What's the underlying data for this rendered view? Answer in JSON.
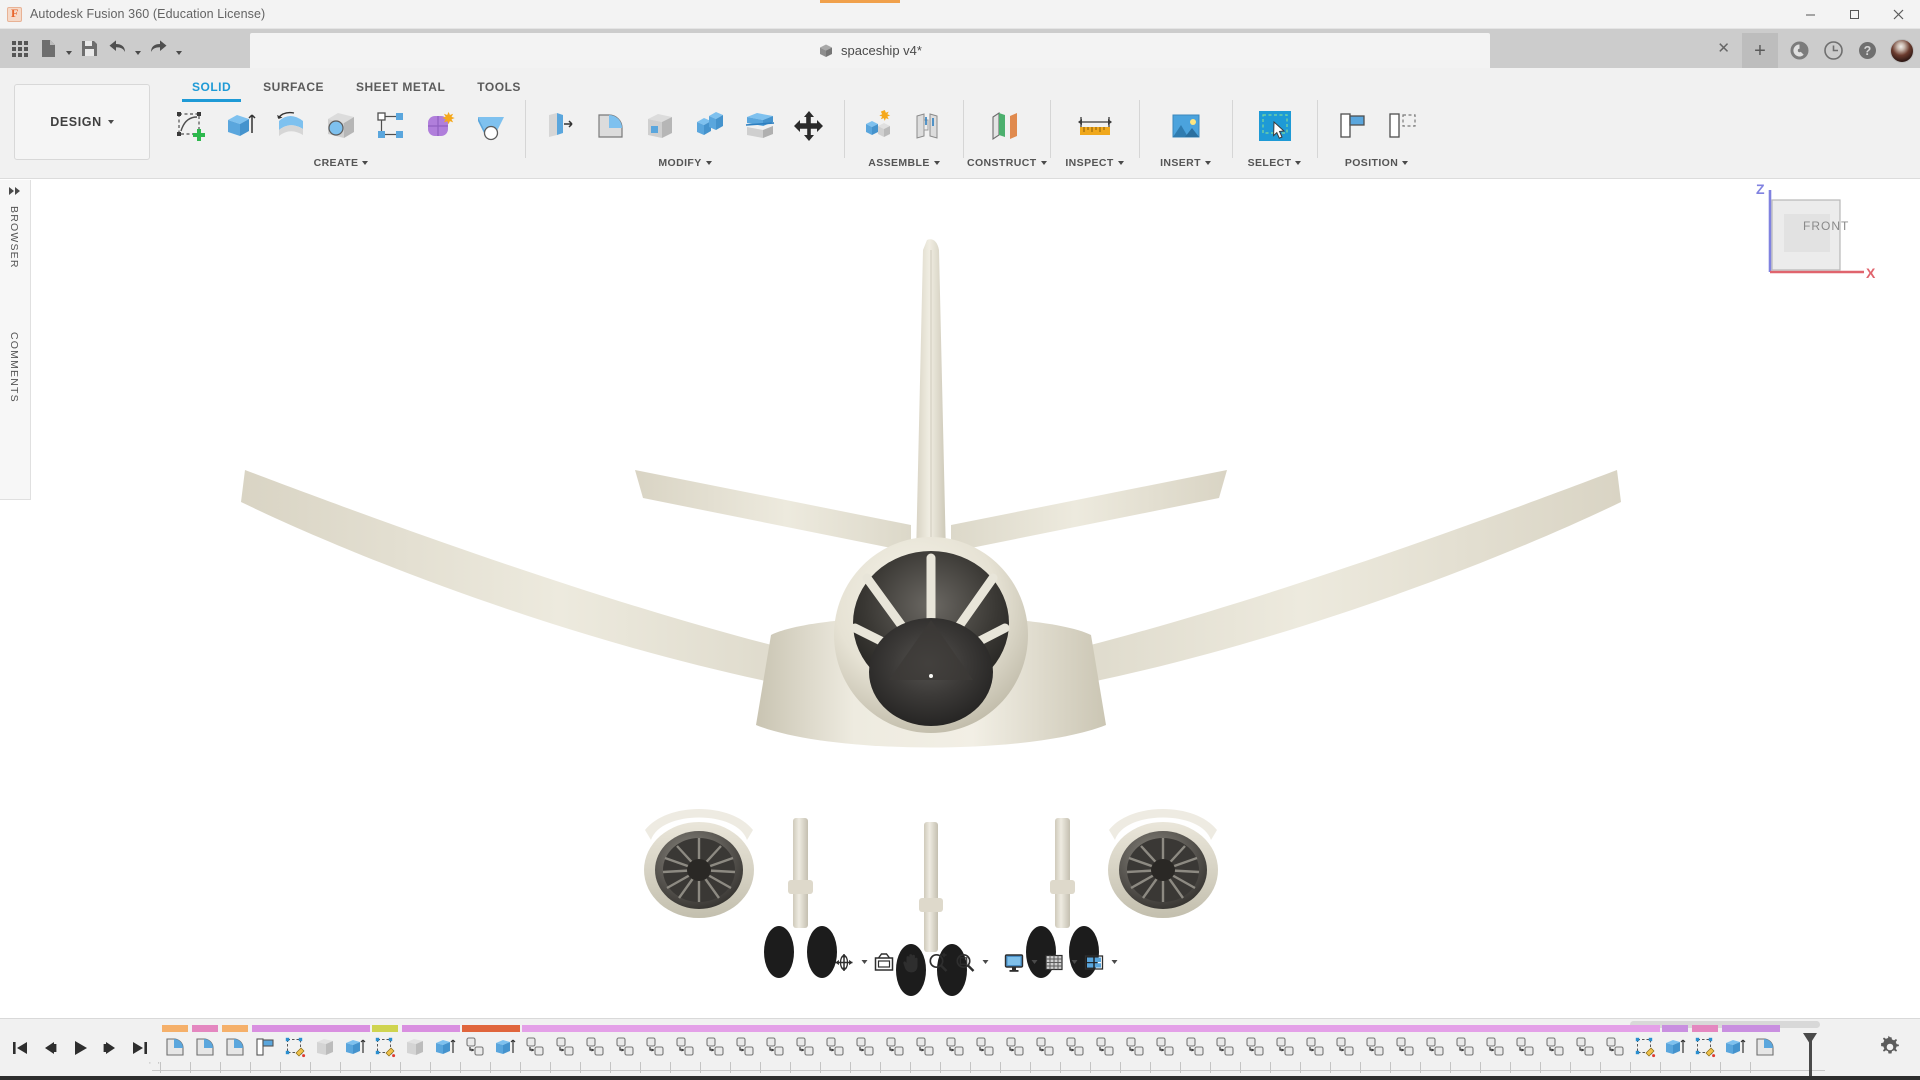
{
  "window": {
    "app_title": "Autodesk Fusion 360 (Education License)",
    "logo_icon": "fusion-logo-icon",
    "minimize_label": "–",
    "maximize_label": "❐",
    "close_label": "✕"
  },
  "quick_access": {
    "app_grid_icon": "app-grid-icon",
    "new_file_icon": "new-file-icon",
    "save_icon": "save-icon",
    "undo_icon": "undo-icon",
    "redo_icon": "redo-icon"
  },
  "document_tab": {
    "title": "spaceship v4*",
    "doc_icon": "cube-icon",
    "close_label": "✕",
    "new_tab_label": "+"
  },
  "top_right": {
    "extensions_icon": "extension-icon",
    "job_status_icon": "clock-icon",
    "help_icon": "help-icon",
    "account_avatar": "user-avatar"
  },
  "ribbon": {
    "workspace": {
      "label": "DESIGN",
      "caret": "▾"
    },
    "tabs": [
      {
        "label": "SOLID",
        "active": true
      },
      {
        "label": "SURFACE",
        "active": false
      },
      {
        "label": "SHEET METAL",
        "active": false
      },
      {
        "label": "TOOLS",
        "active": false
      }
    ],
    "panels": [
      {
        "label": "CREATE",
        "caret": "▾",
        "tools": [
          {
            "name": "create-sketch-tool",
            "icon": "sketch-plus-icon"
          },
          {
            "name": "extrude-tool",
            "icon": "extrude-icon"
          },
          {
            "name": "revolve-tool",
            "icon": "revolve-icon"
          },
          {
            "name": "sweep-tool",
            "icon": "sweep-icon"
          },
          {
            "name": "pattern-tool",
            "icon": "rectangular-pattern-icon"
          },
          {
            "name": "form-tool",
            "icon": "form-sculpt-icon"
          },
          {
            "name": "create-hole-tool",
            "icon": "hole-icon"
          }
        ]
      },
      {
        "label": "MODIFY",
        "caret": "▾",
        "tools": [
          {
            "name": "press-pull-tool",
            "icon": "press-pull-icon"
          },
          {
            "name": "fillet-tool",
            "icon": "fillet-icon"
          },
          {
            "name": "shell-tool",
            "icon": "shell-icon"
          },
          {
            "name": "combine-tool",
            "icon": "combine-icon"
          },
          {
            "name": "split-face-tool",
            "icon": "split-face-icon"
          },
          {
            "name": "move-copy-tool",
            "icon": "move-copy-icon"
          }
        ]
      },
      {
        "label": "ASSEMBLE",
        "caret": "▾",
        "tools": [
          {
            "name": "new-component-tool",
            "icon": "new-component-icon"
          },
          {
            "name": "joint-tool",
            "icon": "joint-icon"
          }
        ]
      },
      {
        "label": "CONSTRUCT",
        "caret": "▾",
        "tools": [
          {
            "name": "offset-plane-tool",
            "icon": "offset-plane-icon"
          }
        ]
      },
      {
        "label": "INSPECT",
        "caret": "▾",
        "tools": [
          {
            "name": "measure-tool",
            "icon": "measure-ruler-icon"
          }
        ]
      },
      {
        "label": "INSERT",
        "caret": "▾",
        "tools": [
          {
            "name": "insert-canvas-tool",
            "icon": "image-icon"
          }
        ]
      },
      {
        "label": "SELECT",
        "caret": "▾",
        "tools": [
          {
            "name": "select-tool",
            "icon": "window-select-icon",
            "active": true
          }
        ]
      },
      {
        "label": "POSITION",
        "caret": "▾",
        "tools": [
          {
            "name": "align-tool",
            "icon": "align-icon"
          },
          {
            "name": "move-position-tool",
            "icon": "position-move-icon"
          }
        ]
      }
    ]
  },
  "left_rail": {
    "collapse_icon": "double-arrow-right-icon",
    "panels": [
      {
        "label": "BROWSER"
      },
      {
        "label": "COMMENTS"
      }
    ]
  },
  "viewcube": {
    "face_label": "FRONT",
    "axis_z_label": "Z",
    "axis_x_label": "X",
    "axis_z_color": "#7b7ce0",
    "axis_x_color": "#e06a72"
  },
  "canvas": {
    "background": "#ffffff",
    "model_name": "airplane-front-view",
    "body_color": "#e6e2d6",
    "engine_color": "#4a4a4a",
    "tire_color": "#1f1f1f"
  },
  "nav_bar": {
    "items": [
      {
        "name": "orbit-button",
        "icon": "orbit-icon",
        "caret": true
      },
      {
        "name": "look-at-button",
        "icon": "look-at-icon",
        "caret": false
      },
      {
        "name": "pan-button",
        "icon": "pan-hand-icon",
        "caret": false
      },
      {
        "name": "zoom-button",
        "icon": "zoom-magnifier-icon",
        "caret": false
      },
      {
        "name": "fit-button",
        "icon": "zoom-fit-icon",
        "caret": true
      },
      {
        "name": "display-settings-button",
        "icon": "monitor-icon",
        "caret": true
      },
      {
        "name": "grid-snaps-button",
        "icon": "grid-icon",
        "caret": true
      },
      {
        "name": "viewports-button",
        "icon": "viewports-icon",
        "caret": true
      }
    ]
  },
  "timeline": {
    "transport": [
      {
        "name": "go-to-beginning-button",
        "icon": "skip-back-icon"
      },
      {
        "name": "step-back-button",
        "icon": "step-back-icon"
      },
      {
        "name": "play-button",
        "icon": "play-icon"
      },
      {
        "name": "step-forward-button",
        "icon": "step-forward-icon"
      },
      {
        "name": "go-to-end-button",
        "icon": "skip-end-icon"
      }
    ],
    "settings_icon": "gear-icon",
    "dots_label": "· ·",
    "features": [
      {
        "icon": "fillet-icon",
        "bar": "#f5b06a"
      },
      {
        "icon": "fillet-icon",
        "bar": "#e487c0"
      },
      {
        "icon": "fillet-icon",
        "bar": "#f5b06a"
      },
      {
        "icon": "align-icon",
        "bar": "#d98fe0"
      },
      {
        "icon": "sketch-icon",
        "bar": "#d98fe0"
      },
      {
        "icon": "shell-icon",
        "bar": "#d98fe0"
      },
      {
        "icon": "extrude-icon",
        "bar": "#d98fe0"
      },
      {
        "icon": "sketch-icon",
        "bar": "#cfd44f"
      },
      {
        "icon": "shell-icon",
        "bar": "#d98fe0"
      },
      {
        "icon": "extrude-icon",
        "bar": "#d98fe0"
      },
      {
        "icon": "copy-paste-icon",
        "bar": "#e0653c"
      },
      {
        "icon": "extrude-icon",
        "bar": "#e0653c"
      },
      {
        "icon": "copy-paste-icon",
        "bar": "#e4a0e8"
      },
      {
        "icon": "copy-paste-icon",
        "bar": "#e4a0e8"
      },
      {
        "icon": "copy-paste-icon",
        "bar": "#e4a0e8"
      },
      {
        "icon": "copy-paste-icon",
        "bar": "#e4a0e8"
      },
      {
        "icon": "copy-paste-icon",
        "bar": "#e4a0e8"
      },
      {
        "icon": "copy-paste-icon",
        "bar": "#e4a0e8"
      },
      {
        "icon": "copy-paste-icon",
        "bar": "#e4a0e8"
      },
      {
        "icon": "copy-paste-icon",
        "bar": "#e4a0e8"
      },
      {
        "icon": "copy-paste-icon",
        "bar": "#e4a0e8"
      },
      {
        "icon": "copy-paste-icon",
        "bar": "#e4a0e8"
      },
      {
        "icon": "copy-paste-icon",
        "bar": "#e4a0e8"
      },
      {
        "icon": "copy-paste-icon",
        "bar": "#e4a0e8"
      },
      {
        "icon": "copy-paste-icon",
        "bar": "#e4a0e8"
      },
      {
        "icon": "copy-paste-icon",
        "bar": "#e4a0e8"
      },
      {
        "icon": "copy-paste-icon",
        "bar": "#e4a0e8"
      },
      {
        "icon": "copy-paste-icon",
        "bar": "#e4a0e8"
      },
      {
        "icon": "copy-paste-icon",
        "bar": "#e4a0e8"
      },
      {
        "icon": "copy-paste-icon",
        "bar": "#e4a0e8"
      },
      {
        "icon": "copy-paste-icon",
        "bar": "#e4a0e8"
      },
      {
        "icon": "copy-paste-icon",
        "bar": "#e4a0e8"
      },
      {
        "icon": "copy-paste-icon",
        "bar": "#e4a0e8"
      },
      {
        "icon": "copy-paste-icon",
        "bar": "#e4a0e8"
      },
      {
        "icon": "copy-paste-icon",
        "bar": "#e4a0e8"
      },
      {
        "icon": "copy-paste-icon",
        "bar": "#e4a0e8"
      },
      {
        "icon": "copy-paste-icon",
        "bar": "#e4a0e8"
      },
      {
        "icon": "copy-paste-icon",
        "bar": "#e4a0e8"
      },
      {
        "icon": "copy-paste-icon",
        "bar": "#e4a0e8"
      },
      {
        "icon": "copy-paste-icon",
        "bar": "#e4a0e8"
      },
      {
        "icon": "copy-paste-icon",
        "bar": "#e4a0e8"
      },
      {
        "icon": "copy-paste-icon",
        "bar": "#e4a0e8"
      },
      {
        "icon": "copy-paste-icon",
        "bar": "#e4a0e8"
      },
      {
        "icon": "copy-paste-icon",
        "bar": "#e4a0e8"
      },
      {
        "icon": "copy-paste-icon",
        "bar": "#e4a0e8"
      },
      {
        "icon": "copy-paste-icon",
        "bar": "#e4a0e8"
      },
      {
        "icon": "copy-paste-icon",
        "bar": "#e4a0e8"
      },
      {
        "icon": "copy-paste-icon",
        "bar": "#e4a0e8"
      },
      {
        "icon": "copy-paste-icon",
        "bar": "#e4a0e8"
      },
      {
        "icon": "sketch-icon",
        "bar": "#e4a0e8"
      },
      {
        "icon": "extrude-icon",
        "bar": "#c98fe0"
      },
      {
        "icon": "sketch-icon",
        "bar": "#e487c0"
      },
      {
        "icon": "extrude-icon",
        "bar": "#c98fe0"
      },
      {
        "icon": "fillet-icon",
        "bar": "#c98fe0"
      }
    ]
  }
}
